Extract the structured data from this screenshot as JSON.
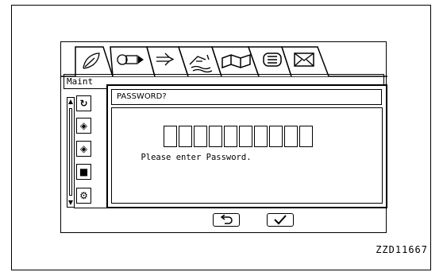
{
  "screen": {
    "tabs": [
      {
        "icon": "leaf-icon"
      },
      {
        "icon": "engine-to-fuel-icon"
      },
      {
        "icon": "arrow-right-icon"
      },
      {
        "icon": "hydraulic-attachment-icon"
      },
      {
        "icon": "manual-book-icon"
      },
      {
        "icon": "menu-list-icon"
      },
      {
        "icon": "mail-icon"
      }
    ],
    "title_partial": "Maint",
    "rows": [
      {
        "icon": "engine-oil-icon",
        "glyph": "↻"
      },
      {
        "icon": "oil-filter-icon",
        "glyph": "◈"
      },
      {
        "icon": "fuel-filter-icon",
        "glyph": "◈"
      },
      {
        "icon": "fuel-prefilter-icon",
        "glyph": "■"
      },
      {
        "icon": "hydraulic-filter-icon",
        "glyph": "⚙"
      }
    ],
    "footer": {
      "back_icon": "return-icon",
      "ok_icon": "check-icon"
    }
  },
  "dialog": {
    "title": "PASSWORD?",
    "box_count": 10,
    "prompt": "Please enter Password."
  },
  "caption": "ZZD11667"
}
